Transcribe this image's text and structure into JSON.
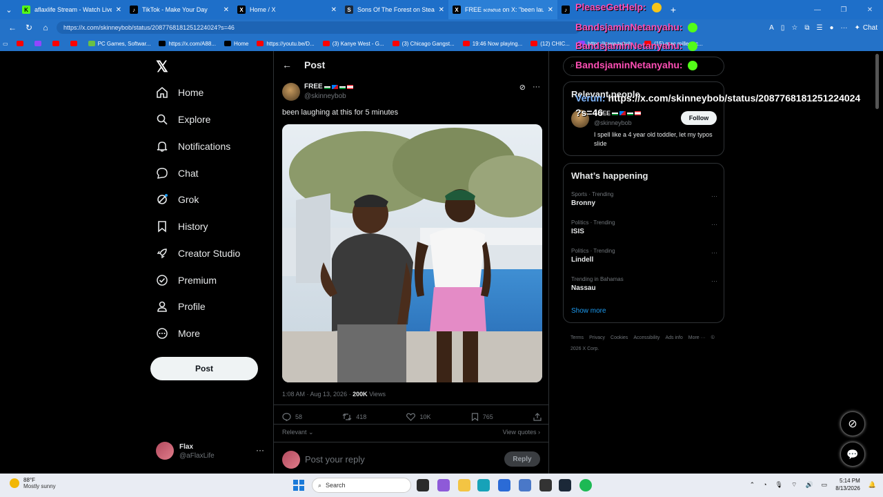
{
  "browser": {
    "tabs": [
      {
        "title": "aflaxlife Stream - Watch Live on Ki",
        "favicon_color": "#53fc18",
        "glyph": "K"
      },
      {
        "title": "TikTok - Make Your Day",
        "favicon_color": "#000000",
        "glyph": "♪"
      },
      {
        "title": "Home / X",
        "favicon_color": "#000000",
        "glyph": "𝕏"
      },
      {
        "title": "Sons Of The Forest on Steam",
        "favicon_color": "#1b2838",
        "glyph": "S"
      },
      {
        "title": "FREE 𝔰𝔠𝔬𝔰𝔬𝔲𝔞 on X: \"been laughing",
        "favicon_color": "#000000",
        "glyph": "𝕏"
      }
    ],
    "url": "https://x.com/skinneybob/status/2087768181251224024?s=46",
    "chat_label": "Chat",
    "bookmarks": [
      {
        "label": "",
        "color": "#ff0000"
      },
      {
        "label": "",
        "color": "#9146ff"
      },
      {
        "label": "",
        "color": "#ff0000"
      },
      {
        "label": "",
        "color": "#ff0000"
      },
      {
        "label": "PC Games, Softwar...",
        "color": "#6ac045"
      },
      {
        "label": "https://x.com/A88...",
        "color": "#000000"
      },
      {
        "label": "Home",
        "color": "#000000"
      },
      {
        "label": "https://youtu.be/D...",
        "color": "#ff0000"
      },
      {
        "label": "(3) Kanye West - G...",
        "color": "#ff0000"
      },
      {
        "label": "(3) Chicago Gangst...",
        "color": "#ff0000"
      },
      {
        "label": "19:46 Now playing...",
        "color": "#ff0000"
      },
      {
        "label": "(12) CHIC...",
        "color": "#ff0000"
      },
      {
        "label": "https://www.twitch...",
        "color": "#9146ff"
      },
      {
        "label": "(15) mac miller - c...",
        "color": "#ff0000"
      }
    ]
  },
  "overlay": {
    "line1": "PleaseGetHelp:",
    "line2": "BandsjaminNetanyahu:",
    "line3": "BandsjaminNetanyahu:",
    "line4": "BandsjaminNetanyahu:",
    "line5_name": "Verun:",
    "line5_text": "https://x.com/skinneybob/status/2087768181251224024",
    "line6": "?s=46"
  },
  "nav": {
    "items": [
      {
        "label": "Home",
        "icon": "home-icon"
      },
      {
        "label": "Explore",
        "icon": "search-icon"
      },
      {
        "label": "Notifications",
        "icon": "bell-icon"
      },
      {
        "label": "Chat",
        "icon": "chat-icon"
      },
      {
        "label": "Grok",
        "icon": "grok-icon"
      },
      {
        "label": "History",
        "icon": "bookmark-icon"
      },
      {
        "label": "Creator Studio",
        "icon": "rocket-icon"
      },
      {
        "label": "Premium",
        "icon": "verified-icon"
      },
      {
        "label": "Profile",
        "icon": "person-icon"
      },
      {
        "label": "More",
        "icon": "more-icon"
      }
    ],
    "post_label": "Post",
    "user": {
      "name": "Flax",
      "handle": "@aFlaxLife"
    }
  },
  "post": {
    "header": "Post",
    "author_name": "FREE",
    "author_handle": "@skinneybob",
    "text": "been laughing at this for 5 minutes",
    "timestamp": "1:08 AM · Aug 13, 2026 · ",
    "views_count": "200K",
    "views_label": " Views",
    "replies": "58",
    "reposts": "418",
    "likes": "10K",
    "bookmarks": "765",
    "relevant_label": "Relevant",
    "view_quotes": "View quotes",
    "reply_placeholder": "Post your reply",
    "reply_button": "Reply"
  },
  "sidebar": {
    "relevant_title": "Relevant people",
    "rp_name": "FREE",
    "rp_handle": "@skinneybob",
    "rp_bio": "I spell like a 4 year old toddler, let my typos slide",
    "follow_label": "Follow",
    "happening_title": "What’s happening",
    "trends": [
      {
        "meta": "Sports · Trending",
        "name": "Bronny"
      },
      {
        "meta": "Politics · Trending",
        "name": "ISIS"
      },
      {
        "meta": "Politics · Trending",
        "name": "Lindell"
      },
      {
        "meta": "Trending in Bahamas",
        "name": "Nassau"
      }
    ],
    "show_more": "Show more",
    "footer": [
      "Terms",
      "Privacy",
      "Cookies",
      "Accessibility",
      "Ads info",
      "More ···",
      "© 2026 X Corp."
    ]
  },
  "taskbar": {
    "temp": "88°F",
    "weather": "Mostly sunny",
    "search_placeholder": "Search",
    "time": "5:14 PM",
    "date": "8/13/2026"
  }
}
